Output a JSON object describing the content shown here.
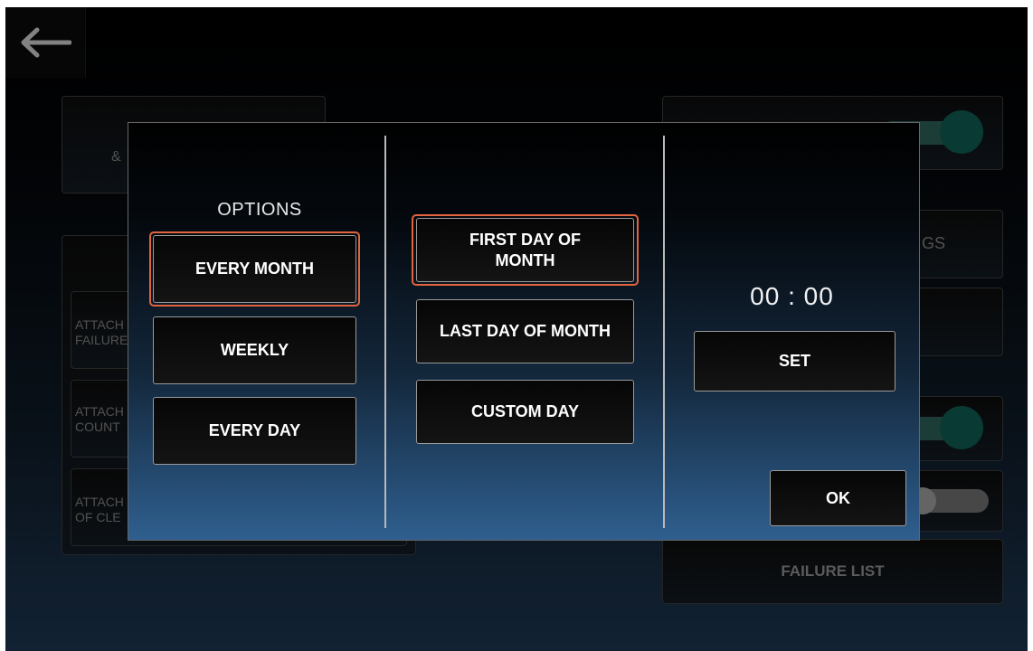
{
  "background": {
    "card_top_left_text": "&",
    "card_right_2_text": "GS",
    "rows": [
      {
        "line1": "ATTACH",
        "line2": "FAILURE"
      },
      {
        "line1": "ATTACH",
        "line2": "COUNT"
      },
      {
        "line1": "ATTACH",
        "line2": "OF CLE"
      }
    ],
    "failure_list_label": "FAILURE LIST"
  },
  "dialog": {
    "options_title": "OPTIONS",
    "options": [
      {
        "label": "EVERY MONTH",
        "selected": true
      },
      {
        "label": "WEEKLY",
        "selected": false
      },
      {
        "label": "EVERY DAY",
        "selected": false
      }
    ],
    "day_options": [
      {
        "label": "FIRST DAY OF MONTH",
        "selected": true
      },
      {
        "label": "LAST DAY OF MONTH",
        "selected": false
      },
      {
        "label": "CUSTOM DAY",
        "selected": false
      }
    ],
    "time": "00 : 00",
    "set_label": "SET",
    "ok_label": "OK"
  },
  "colors": {
    "selection": "#e2643c",
    "toggle_on": "#0f5a4f"
  },
  "icons": {
    "back": "arrow-left-icon"
  }
}
